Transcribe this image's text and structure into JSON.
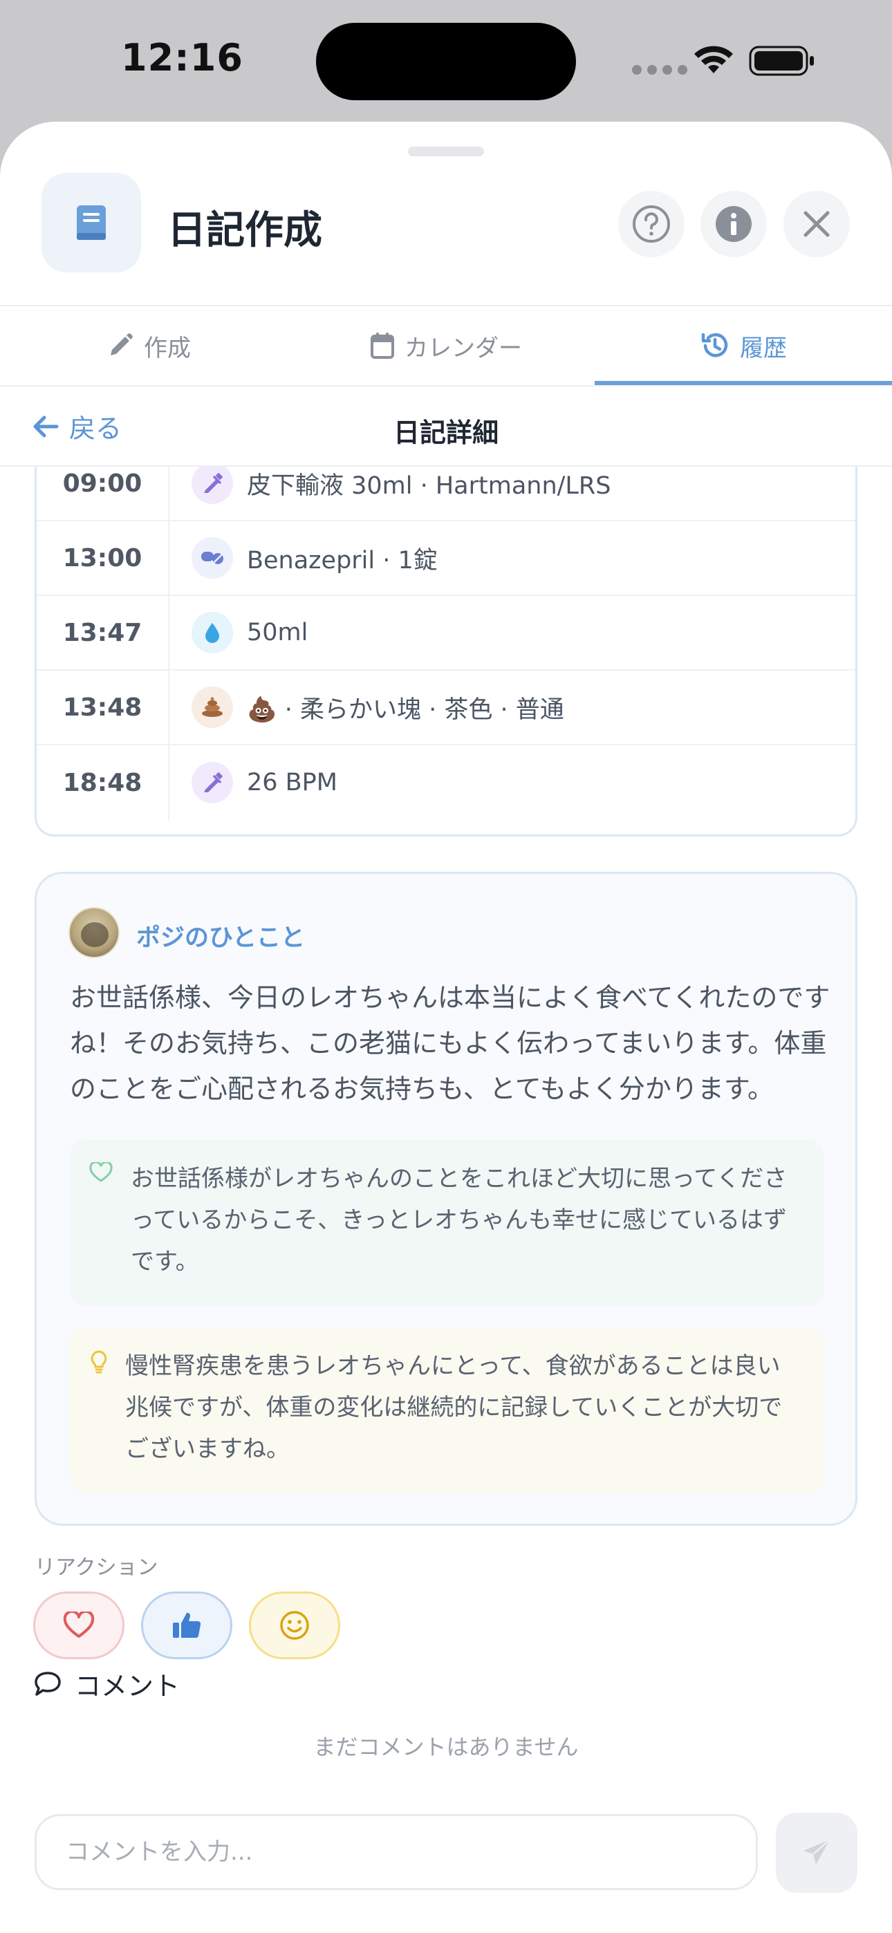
{
  "status_bar": {
    "time": "12:16"
  },
  "header": {
    "title": "日記作成",
    "icon": "book-icon",
    "buttons": [
      "help-icon",
      "info-icon",
      "close-icon"
    ]
  },
  "tabs": [
    {
      "label": "作成",
      "icon": "pencil-icon",
      "active": false
    },
    {
      "label": "カレンダー",
      "icon": "calendar-icon",
      "active": false
    },
    {
      "label": "履歴",
      "icon": "history-icon",
      "active": true
    }
  ],
  "detail": {
    "back_label": "戻る",
    "title": "日記詳細"
  },
  "timeline": [
    {
      "time": "09:00",
      "icon": "syringe-icon",
      "icon_bg": "#f1eafd",
      "text": "皮下輸液 30ml · Hartmann/LRS"
    },
    {
      "time": "13:00",
      "icon": "pill-icon",
      "icon_bg": "#eef0fb",
      "text": "Benazepril · 1錠"
    },
    {
      "time": "13:47",
      "icon": "water-drop-icon",
      "icon_bg": "#e6f4fc",
      "text": "50ml"
    },
    {
      "time": "13:48",
      "icon": "poop-icon",
      "icon_bg": "#f7ede4",
      "text": "💩 · 柔らかい塊 · 茶色 · 普通"
    },
    {
      "time": "18:48",
      "icon": "syringe-icon",
      "icon_bg": "#f1eafd",
      "text": "26 BPM"
    }
  ],
  "posi": {
    "name": "ポジのひとこと",
    "message": "お世話係様、今日のレオちゃんは本当によく食べてくれたのですね！そのお気持ち、この老猫にもよく伝わってまいります。体重のことをご心配されるお気持ちも、とてもよく分かります。",
    "note_heart": "お世話係様がレオちゃんのことをこれほど大切に思ってくださっているからこそ、きっとレオちゃんも幸せに感じているはずです。",
    "note_tip": "慢性腎疾患を患うレオちゃんにとって、食欲があることは良い兆候ですが、体重の変化は継続的に記録していくことが大切でございますね。"
  },
  "reactions": {
    "label": "リアクション",
    "items": [
      "heart-icon",
      "thumbs-up-icon",
      "smile-icon"
    ]
  },
  "comments": {
    "title": "コメント",
    "empty_text": "まだコメントはありません",
    "placeholder": "コメントを入力..."
  },
  "colors": {
    "accent": "#5b95d6",
    "border": "#dbe7f3"
  }
}
